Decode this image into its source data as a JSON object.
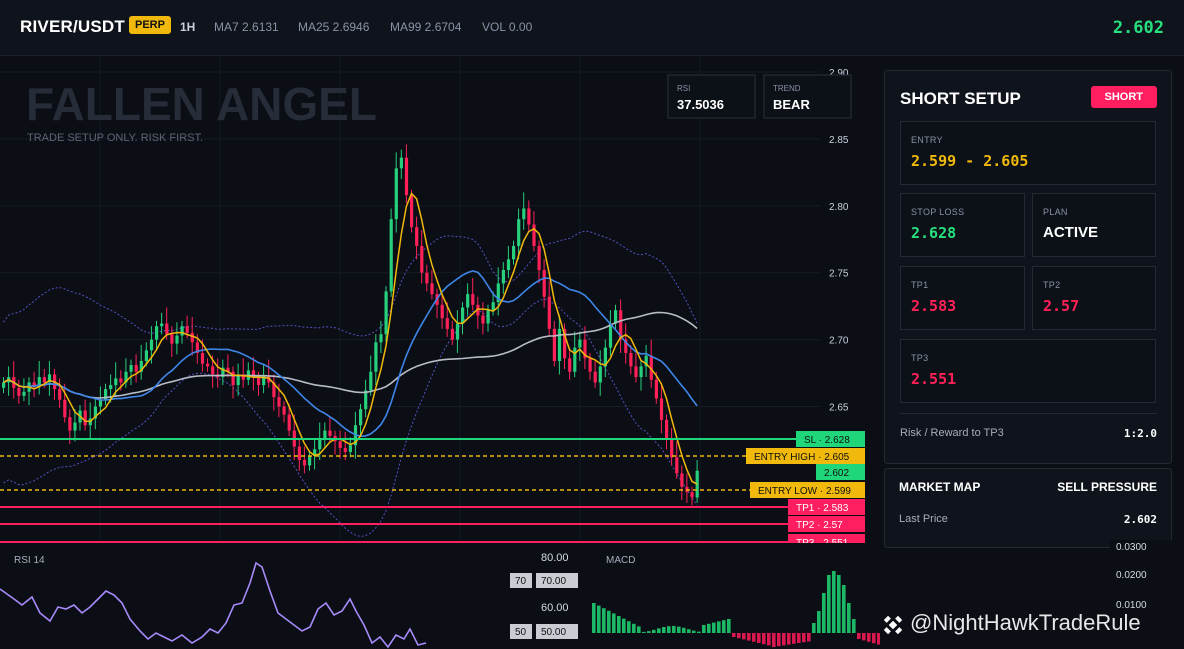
{
  "header": {
    "pair": "RIVER/USDT",
    "badge": "PERP",
    "timeframe": "1H",
    "ma7": "MA7 2.6131",
    "ma25": "MA25 2.6946",
    "ma99": "MA99 2.6704",
    "vol": "VOL 0.00",
    "last_price": "2.602"
  },
  "overlay": {
    "title": "FALLEN ANGEL",
    "subtitle": "TRADE SETUP ONLY. RISK FIRST.",
    "rsi_label": "RSI",
    "rsi_value": "37.5036",
    "trend_label": "TREND",
    "trend_value": "BEAR"
  },
  "price_axis": [
    "2.90",
    "2.85",
    "2.80",
    "2.75",
    "2.70",
    "2.65"
  ],
  "levels": {
    "sl": "SL · 2.628",
    "entry_high": "ENTRY HIGH · 2.605",
    "last": "2.602",
    "entry_low": "ENTRY LOW · 2.599",
    "tp1": "TP1 · 2.583",
    "tp2": "TP2 · 2.57",
    "tp3": "TP3 · 2.551"
  },
  "setup": {
    "title": "SHORT SETUP",
    "button": "SHORT",
    "entry_label": "ENTRY",
    "entry_value": "2.599 - 2.605",
    "stop_label": "STOP LOSS",
    "stop_value": "2.628",
    "plan_label": "PLAN",
    "plan_value": "ACTIVE",
    "tp1_label": "TP1",
    "tp1_value": "2.583",
    "tp2_label": "TP2",
    "tp2_value": "2.57",
    "tp3_label": "TP3",
    "tp3_value": "2.551",
    "rr_label": "Risk / Reward to TP3",
    "rr_value": "1:2.0"
  },
  "market_map": {
    "title": "MARKET MAP",
    "pressure": "SELL PRESSURE",
    "last_label": "Last Price",
    "last_value": "2.602"
  },
  "rsi_panel": {
    "title": "RSI 14",
    "axis": [
      "80.00",
      "60.00"
    ],
    "tag70": "70",
    "val70": "70.00",
    "tag50": "50",
    "val50": "50.00"
  },
  "macd_panel": {
    "title": "MACD",
    "axis": [
      "0.0300",
      "0.0200",
      "0.0100"
    ]
  },
  "watermark": "@NightHawkTradeRule",
  "colors": {
    "up": "#26d07c",
    "down": "#ff2058",
    "accent": "#f0b90b",
    "ma7": "#f0b90b",
    "ma25": "#3f86e8",
    "ma99": "#b8bcc6"
  }
}
